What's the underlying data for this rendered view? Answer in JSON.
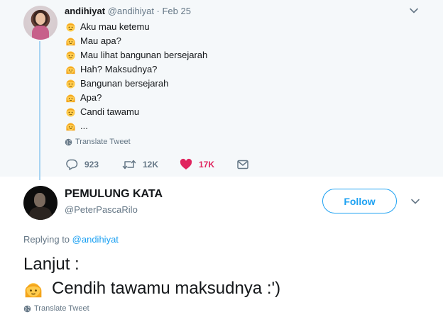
{
  "tweet": {
    "display_name": "andihiyat",
    "handle_date": "@andihiyat · Feb 25",
    "lines": [
      {
        "emoji": "man-emoji",
        "text": "Aku mau ketemu"
      },
      {
        "emoji": "woman-emoji",
        "text": "Mau apa?"
      },
      {
        "emoji": "man-emoji",
        "text": "Mau lihat bangunan bersejarah"
      },
      {
        "emoji": "woman-emoji",
        "text": "Hah? Maksudnya?"
      },
      {
        "emoji": "man-emoji",
        "text": "Bangunan bersejarah"
      },
      {
        "emoji": "woman-emoji",
        "text": "Apa?"
      },
      {
        "emoji": "man-emoji",
        "text": "Candi tawamu"
      },
      {
        "emoji": "woman-emoji",
        "text": "..."
      }
    ],
    "translate_label": "Translate Tweet",
    "actions": {
      "replies": "923",
      "retweets": "12K",
      "likes": "17K"
    }
  },
  "reply": {
    "display_name": "PEMULUNG KATA",
    "handle": "@PeterPascaRilo",
    "follow_label": "Follow",
    "replying_prefix": "Replying to",
    "replying_to": "@andihiyat",
    "line1": "Lanjut :",
    "line2": "Cendih tawamu maksudnya :')",
    "translate_label": "Translate Tweet"
  },
  "colors": {
    "accent": "#1da1f2",
    "like": "#e0245e",
    "muted": "#657786",
    "quoted_bg": "#f5f8fa",
    "thread_line": "#a9d4f2"
  },
  "icons": [
    "chevron-down-icon",
    "globe-icon",
    "reply-icon",
    "retweet-icon",
    "heart-icon",
    "message-icon"
  ]
}
